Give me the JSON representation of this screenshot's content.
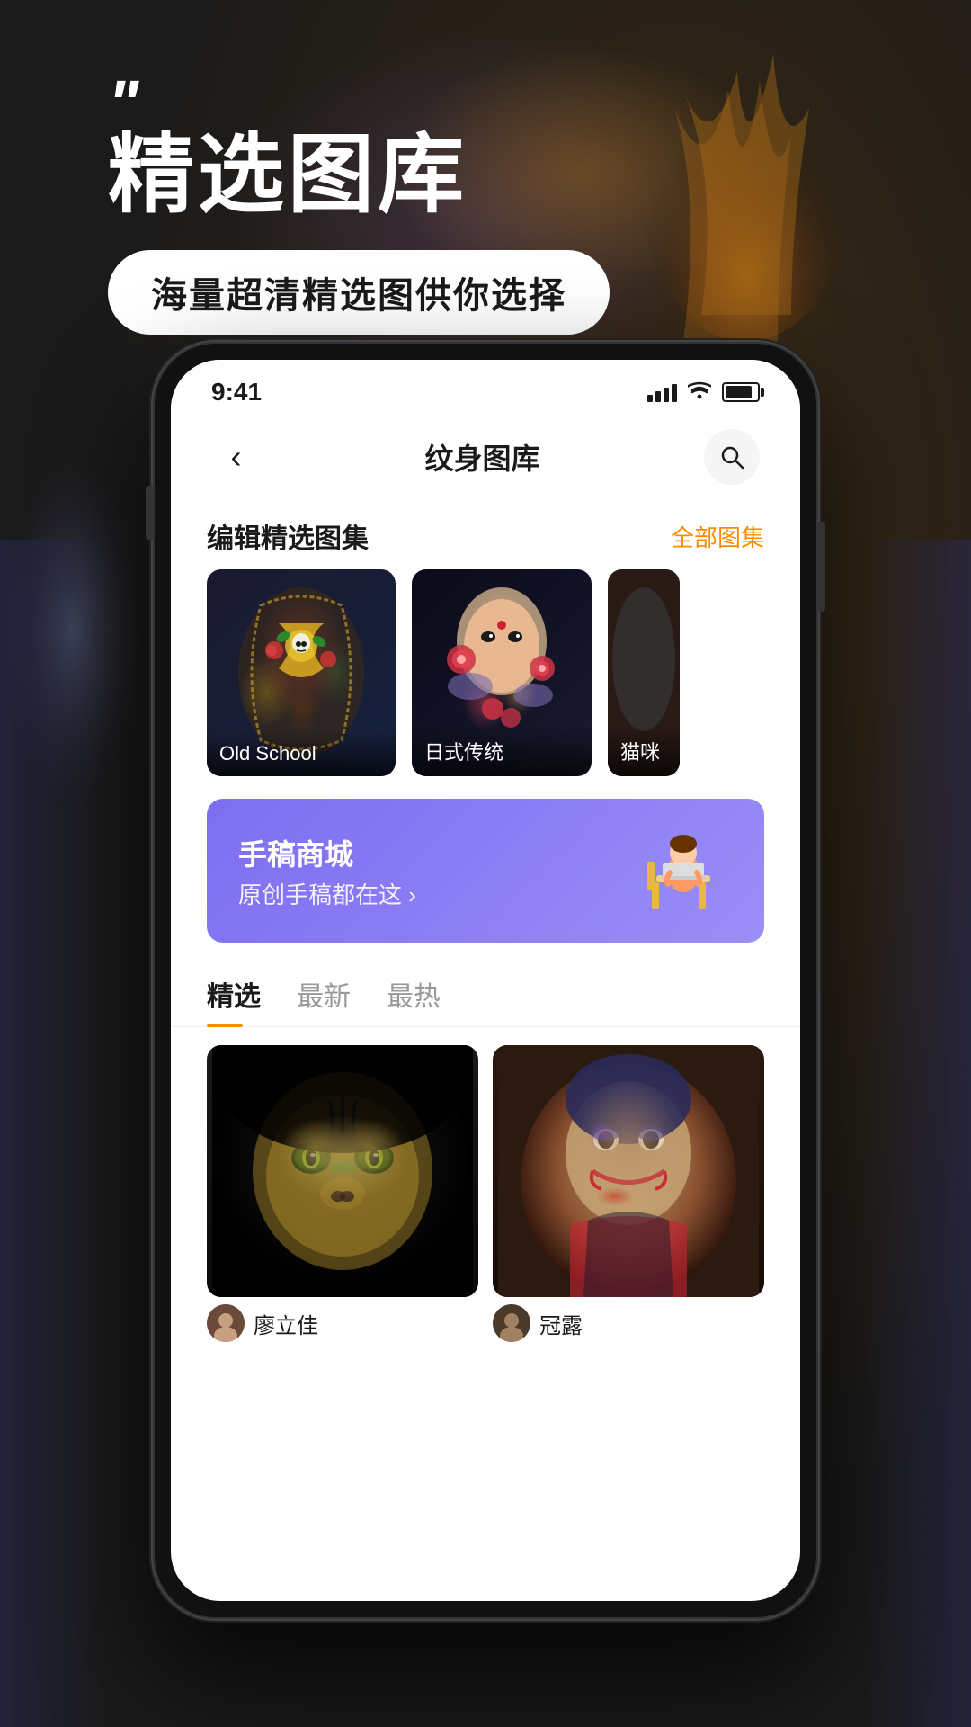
{
  "background": {
    "color": "#1a1a1a"
  },
  "header": {
    "quote_marks": "\"",
    "main_title": "精选图库",
    "subtitle": "海量超清精选图供你选择"
  },
  "status_bar": {
    "time": "9:41",
    "signal_bars": [
      3,
      4,
      5,
      6
    ],
    "wifi": "wifi",
    "battery_level": 85
  },
  "navigation": {
    "back_label": "‹",
    "title": "纹身图库",
    "search_icon": "search"
  },
  "editor_picks": {
    "section_title": "编辑精选图集",
    "all_link": "全部图集",
    "items": [
      {
        "id": "old-school",
        "label": "Old School",
        "style": "old-school"
      },
      {
        "id": "japanese",
        "label": "日式传统",
        "style": "japanese"
      },
      {
        "id": "cat",
        "label": "猫咪",
        "style": "cat"
      }
    ]
  },
  "banner": {
    "title": "手稿商城",
    "subtitle": "原创手稿都在这 ›",
    "illustration": "person-laptop"
  },
  "tabs": [
    {
      "id": "featured",
      "label": "精选",
      "active": true
    },
    {
      "id": "latest",
      "label": "最新",
      "active": false
    },
    {
      "id": "hottest",
      "label": "最热",
      "active": false
    }
  ],
  "gallery_items": [
    {
      "id": "tiger",
      "style": "tiger",
      "author": "廖立佳",
      "author_id": "liao"
    },
    {
      "id": "joker",
      "style": "joker",
      "author": "冠露",
      "author_id": "guan"
    }
  ]
}
